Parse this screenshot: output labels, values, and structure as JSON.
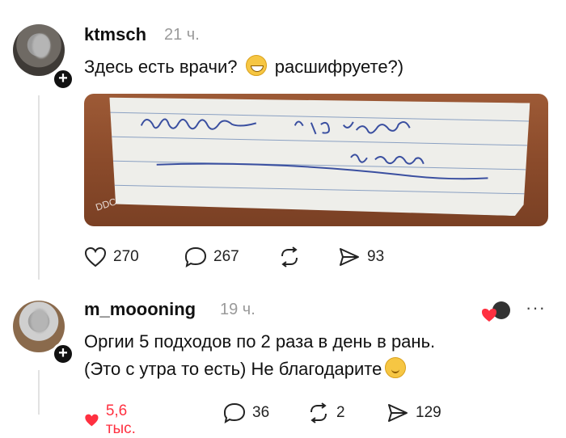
{
  "post1": {
    "username": "ktmsch",
    "time": "21 ч.",
    "text_before": "Здесь есть врачи?",
    "text_after": "расшифруете?)",
    "emoji": "grinning-face",
    "image_watermark": "DDC",
    "handwritten_note": "Оргии 5 по 2 раза в день в рань.",
    "likes": "270",
    "comments": "267",
    "shares": "93"
  },
  "post2": {
    "username": "m_moooning",
    "time": "19 ч.",
    "line1": "Оргии 5 подходов по 2 раза в день в рань.",
    "line2": "(Это с утра то есть) Не благодарите",
    "emoji": "relieved-face",
    "likes": "5,6 тыс.",
    "comments": "36",
    "reposts": "2",
    "shares": "129"
  },
  "colors": {
    "like_active": "#ff3040",
    "muted": "#9a9a9a"
  }
}
